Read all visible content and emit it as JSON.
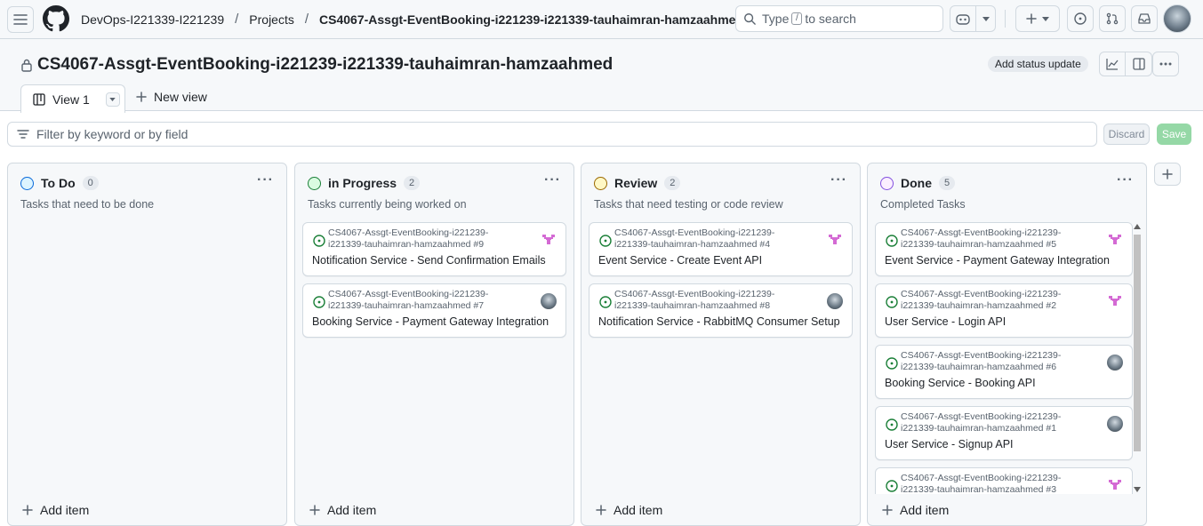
{
  "nav": {
    "org": "DevOps-I221339-I221239",
    "projects": "Projects",
    "project_name": "CS4067-Assgt-EventBooking-i221239-i221339-tauhaimran-hamzaahmed",
    "search_prefix": "Type",
    "search_key": "/",
    "search_suffix": "to search"
  },
  "project": {
    "title": "CS4067-Assgt-EventBooking-i221239-i221339-tauhaimran-hamzaahmed",
    "status_update": "Add status update",
    "view_tab": "View 1",
    "new_view": "New view"
  },
  "filter": {
    "placeholder": "Filter by keyword or by field",
    "discard": "Discard",
    "save": "Save"
  },
  "board": {
    "add_item": "Add item",
    "columns": [
      {
        "name": "To Do",
        "count": "0",
        "description": "Tasks that need to be done",
        "color": "#0969da",
        "cards": []
      },
      {
        "name": "in Progress",
        "count": "2",
        "description": "Tasks currently being worked on",
        "color": "#1a7f37",
        "cards": [
          {
            "repo_line1": "CS4067-Assgt-EventBooking-i221239-",
            "repo_line2": "i221339-tauhaimran-hamzaahmed #9",
            "title": "Notification Service - Send Confirmation Emails",
            "avatar": "pink"
          },
          {
            "repo_line1": "CS4067-Assgt-EventBooking-i221239-",
            "repo_line2": "i221339-tauhaimran-hamzaahmed #7",
            "title": "Booking Service - Payment Gateway Integration",
            "avatar": "photo"
          }
        ]
      },
      {
        "name": "Review",
        "count": "2",
        "description": "Tasks that need testing or code review",
        "color": "#9a6700",
        "cards": [
          {
            "repo_line1": "CS4067-Assgt-EventBooking-i221239-",
            "repo_line2": "i221339-tauhaimran-hamzaahmed #4",
            "title": "Event Service - Create Event API",
            "avatar": "pink"
          },
          {
            "repo_line1": "CS4067-Assgt-EventBooking-i221239-",
            "repo_line2": "i221339-tauhaimran-hamzaahmed #8",
            "title": "Notification Service - RabbitMQ Consumer Setup",
            "avatar": "photo"
          }
        ]
      },
      {
        "name": "Done",
        "count": "5",
        "description": "Completed Tasks",
        "color": "#8250df",
        "cards": [
          {
            "repo_line1": "CS4067-Assgt-EventBooking-i221239-",
            "repo_line2": "i221339-tauhaimran-hamzaahmed #5",
            "title": "Event Service - Payment Gateway Integration",
            "avatar": "pink"
          },
          {
            "repo_line1": "CS4067-Assgt-EventBooking-i221239-",
            "repo_line2": "i221339-tauhaimran-hamzaahmed #2",
            "title": "User Service - Login API",
            "avatar": "pink"
          },
          {
            "repo_line1": "CS4067-Assgt-EventBooking-i221239-",
            "repo_line2": "i221339-tauhaimran-hamzaahmed #6",
            "title": "Booking Service - Booking API",
            "avatar": "photo"
          },
          {
            "repo_line1": "CS4067-Assgt-EventBooking-i221239-",
            "repo_line2": "i221339-tauhaimran-hamzaahmed #1",
            "title": "User Service - Signup API",
            "avatar": "photo"
          },
          {
            "repo_line1": "CS4067-Assgt-EventBooking-i221239-",
            "repo_line2": "i221339-tauhaimran-hamzaahmed #3",
            "title": "",
            "avatar": "pink"
          }
        ]
      }
    ]
  }
}
